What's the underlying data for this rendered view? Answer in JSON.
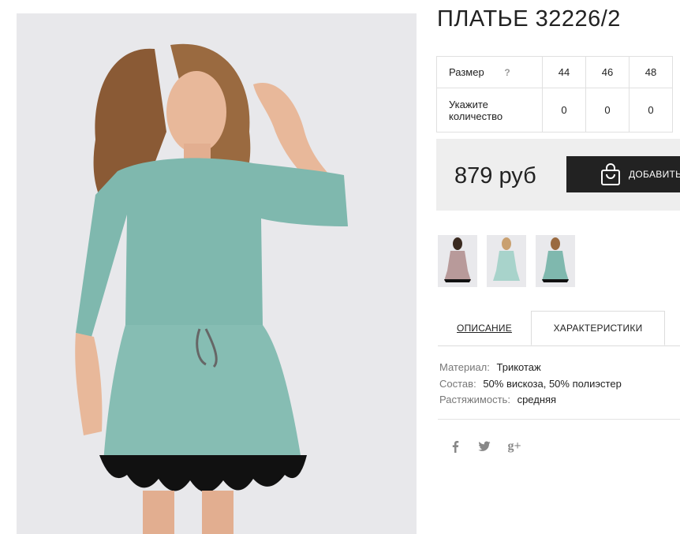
{
  "product": {
    "title": "ПЛАТЬЕ 32226/2",
    "size_label": "Размер",
    "size_hint": "?",
    "sizes": [
      "44",
      "46",
      "48"
    ],
    "qty_label": "Укажите количество",
    "quantities": [
      "0",
      "0",
      "0"
    ],
    "price": "879 руб",
    "add_to_cart": "ДОБАВИТЬ"
  },
  "tabs": {
    "description": "ОПИСАНИЕ",
    "characteristics": "ХАРАКТЕРИСТИКИ"
  },
  "specs": [
    {
      "key": "Материал:",
      "value": "Трикотаж"
    },
    {
      "key": "Состав:",
      "value": "50% вискоза, 50% полиэстер"
    },
    {
      "key": "Растяжимость:",
      "value": "средняя"
    }
  ],
  "social": {
    "icons": [
      "facebook-icon",
      "twitter-icon",
      "google-plus-icon"
    ],
    "labels": [
      "f",
      "t",
      "g+"
    ]
  },
  "colors": {
    "dress": "#7fb8ae",
    "button": "#222222",
    "price_bg": "#eeeeee",
    "image_bg": "#e9e9ec"
  }
}
